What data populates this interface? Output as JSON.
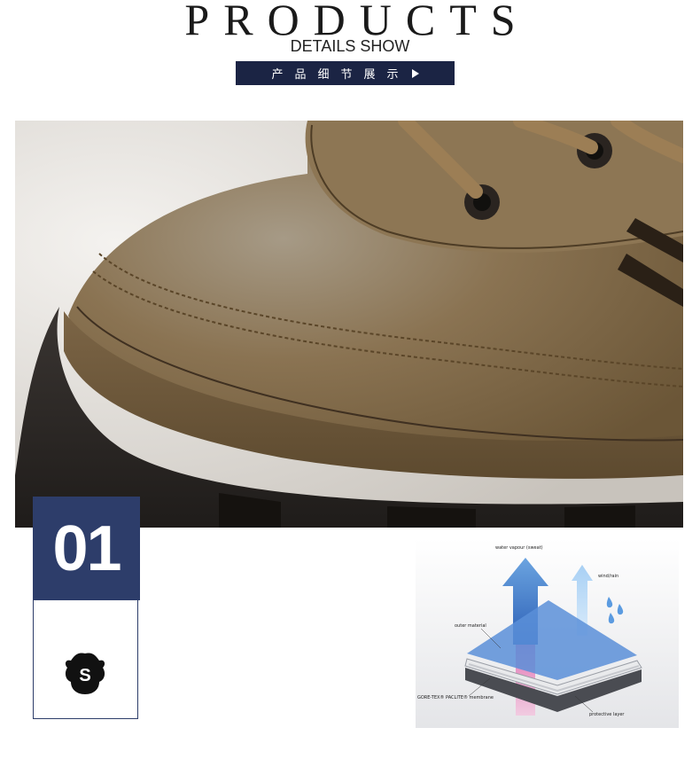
{
  "header": {
    "title": "PRODUCTS",
    "subtitle": "DETAILS SHOW",
    "badge_label": "产品细节展示"
  },
  "feature": {
    "number": "01",
    "icon": "leather-s-icon",
    "icon_letter": "S"
  },
  "diagram": {
    "labels": {
      "water_vapour": "water vapour (sweat)",
      "wind_rain": "wind/rain",
      "outer_material": "outer material",
      "membrane": "GORE-TEX® PACLITE® membrane",
      "protective_layer": "protective layer"
    }
  },
  "colors": {
    "navy": "#2d3d6a",
    "badge_bg": "#1b2444",
    "leather_brown": "#8a7352",
    "sole": "#2b2724"
  }
}
